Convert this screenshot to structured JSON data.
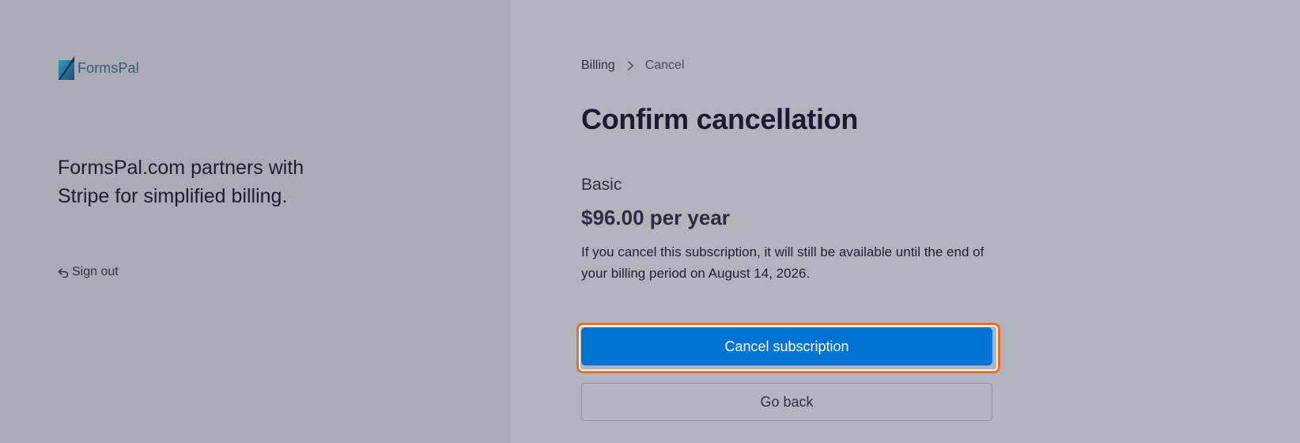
{
  "brand": {
    "logo_text": "FormsPal",
    "logo_icon": "formspal-logo-icon",
    "tagline": "FormsPal.com partners with Stripe for simplified billing."
  },
  "account": {
    "sign_out_label": "Sign out",
    "sign_out_icon": "sign-out-arrow-icon"
  },
  "breadcrumb": {
    "parent": "Billing",
    "separator_icon": "chevron-right-icon",
    "current": "Cancel"
  },
  "main": {
    "title": "Confirm cancellation",
    "plan_name": "Basic",
    "plan_price": "$96.00 per year",
    "note": "If you cancel this subscription, it will still be available until the end of your billing period on August 14, 2026.",
    "cancel_button_label": "Cancel subscription",
    "go_back_button_label": "Go back"
  },
  "colors": {
    "left_background": "#a9abb5",
    "right_background": "#b3b3bd",
    "primary_button": "#0074d6",
    "highlight_outline": "#e9702a"
  }
}
